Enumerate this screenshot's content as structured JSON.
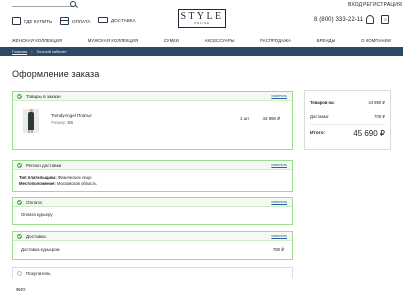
{
  "header": {
    "auth": {
      "login": "ВХОД",
      "register": "РЕГИСТРАЦИЯ"
    },
    "links": [
      {
        "label": "ГДЕ КУПИТЬ",
        "icon": "thumbs-up-icon"
      },
      {
        "label": "ОПЛАТА",
        "icon": "credit-card-icon"
      },
      {
        "label": "ДОСТАВКА",
        "icon": "truck-icon"
      }
    ],
    "logo": {
      "main": "STYLE",
      "sub": "ONLINE"
    },
    "phone": "8 (800) 333-22-11",
    "cart_count": "0"
  },
  "nav": [
    "ЖЕНСКАЯ КОЛЛЕКЦИЯ",
    "МУЖСКАЯ КОЛЛЕКЦИЯ",
    "СУМКИ",
    "АКСЕССУАРЫ",
    "РАСПРОДАЖА",
    "БРЕНДЫ",
    "О КОМПАНИИ"
  ],
  "breadcrumb": {
    "home": "Главная",
    "separator": "›",
    "current": "Личный кабинет"
  },
  "page_title": "Оформление заказа",
  "edit_label": "изменить",
  "sections": {
    "items": {
      "title": "Товары в заказе",
      "product": {
        "name": "TrendyAngel Платье",
        "size_label": "Размер",
        "size_value": "XS",
        "qty": "1 шт",
        "price": "44 990 ₽"
      }
    },
    "region": {
      "title": "Регион доставки",
      "payer_label": "Тип плательщика:",
      "payer_value": "Физическое лицо",
      "location_label": "Местоположение:",
      "location_value": "Московская область"
    },
    "payment": {
      "title": "Оплата",
      "method": "Оплата курьеру"
    },
    "delivery": {
      "title": "Доставка",
      "method": "Доставка курьером",
      "price": "780 ₽"
    },
    "buyer": {
      "title": "Покупатель",
      "fio_label": "ФИО"
    }
  },
  "summary": {
    "goods_label": "Товаров на:",
    "goods_value": "44 990 ₽",
    "delivery_label": "Доставка:",
    "delivery_value": "700 ₽",
    "total_label": "Итого:",
    "total_value": "45 690 ₽"
  },
  "colors": {
    "accent_green": "#9bdc8e",
    "check_green": "#4caf50",
    "nav_band": "#2c4a66"
  }
}
